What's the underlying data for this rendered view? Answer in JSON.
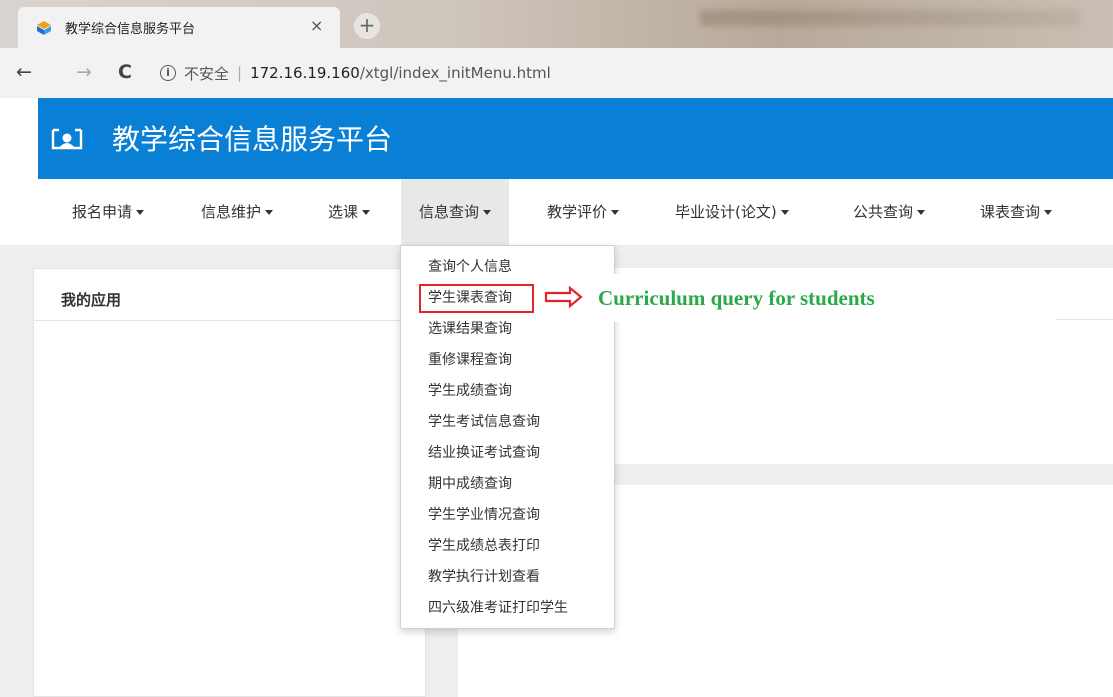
{
  "browser": {
    "tab_title": "教学综合信息服务平台",
    "tab_close": "×",
    "new_tab": "+",
    "back": "←",
    "forward": "→",
    "reload": "C",
    "info_icon": "i",
    "insecure_label": "不安全",
    "separator": "|",
    "url_host": "172.16.19.160",
    "url_path": "/xtgl/index_initMenu.html"
  },
  "header": {
    "title": "教学综合信息服务平台",
    "bg_color": "#0a7fd6"
  },
  "menu": {
    "items": [
      {
        "label": "报名申请"
      },
      {
        "label": "信息维护"
      },
      {
        "label": "选课"
      },
      {
        "label": "信息查询",
        "active": true
      },
      {
        "label": "教学评价"
      },
      {
        "label": "毕业设计(论文)"
      },
      {
        "label": "公共查询"
      },
      {
        "label": "课表查询"
      }
    ]
  },
  "dropdown": {
    "items": [
      {
        "label": "查询个人信息"
      },
      {
        "label": "学生课表查询",
        "highlighted": true
      },
      {
        "label": "选课结果查询"
      },
      {
        "label": "重修课程查询"
      },
      {
        "label": "学生成绩查询"
      },
      {
        "label": "学生考试信息查询"
      },
      {
        "label": "结业换证考试查询"
      },
      {
        "label": "期中成绩查询"
      },
      {
        "label": "学生学业情况查询"
      },
      {
        "label": "学生成绩总表打印"
      },
      {
        "label": "教学执行计划查看"
      },
      {
        "label": "四六级准考证打印学生"
      }
    ]
  },
  "panels": {
    "my_apps_title": "我的应用"
  },
  "annotation": {
    "text": "Curriculum query for students",
    "color": "#2aa84a",
    "highlight_color": "#e0252b"
  }
}
